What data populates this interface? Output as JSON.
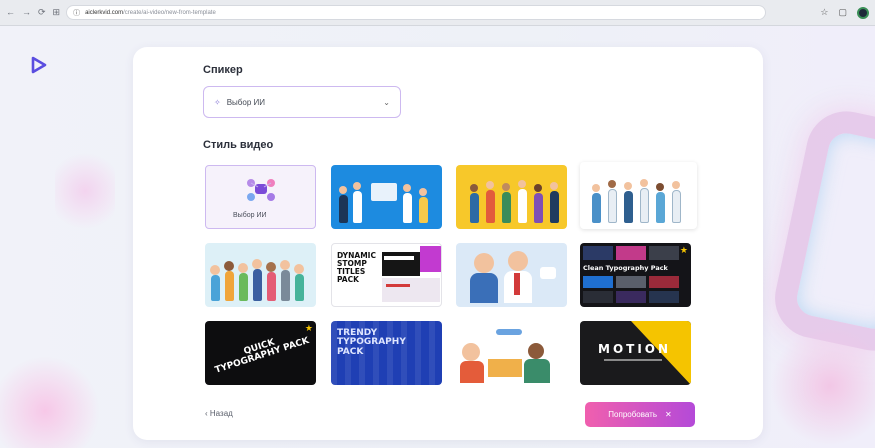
{
  "browser": {
    "nav_icons": [
      "back-icon",
      "forward-icon",
      "reload-icon",
      "tabs-icon"
    ],
    "url_host": "aiclerkvid.com",
    "url_path": "/create/ai-video/new-from-template",
    "right_icons": [
      "star-icon",
      "extensions-icon"
    ]
  },
  "form": {
    "speaker_label": "Спикер",
    "speaker_select": {
      "value": "Выбор ИИ"
    },
    "style_label": "Стиль видео",
    "tiles": [
      {
        "label": "Выбор ИИ",
        "selected": true
      },
      {
        "label": ""
      },
      {
        "label": ""
      },
      {
        "label": ""
      },
      {
        "label": ""
      },
      {
        "label": "DYNAMIC STOMP TITLES PACK"
      },
      {
        "label": ""
      },
      {
        "label": "Clean Typography Pack"
      },
      {
        "label": "QUICK TYPOGRAPHY PACK"
      },
      {
        "label": "TRENDY TYPOGRAPHY PACK"
      },
      {
        "label": ""
      },
      {
        "label": "MOTION"
      }
    ],
    "back_label": "Назад",
    "submit_label": "Попробовать"
  },
  "colors": {
    "accent": "#b44ad8",
    "accent_pink": "#f05fae",
    "select_border": "#cdb9f0"
  }
}
